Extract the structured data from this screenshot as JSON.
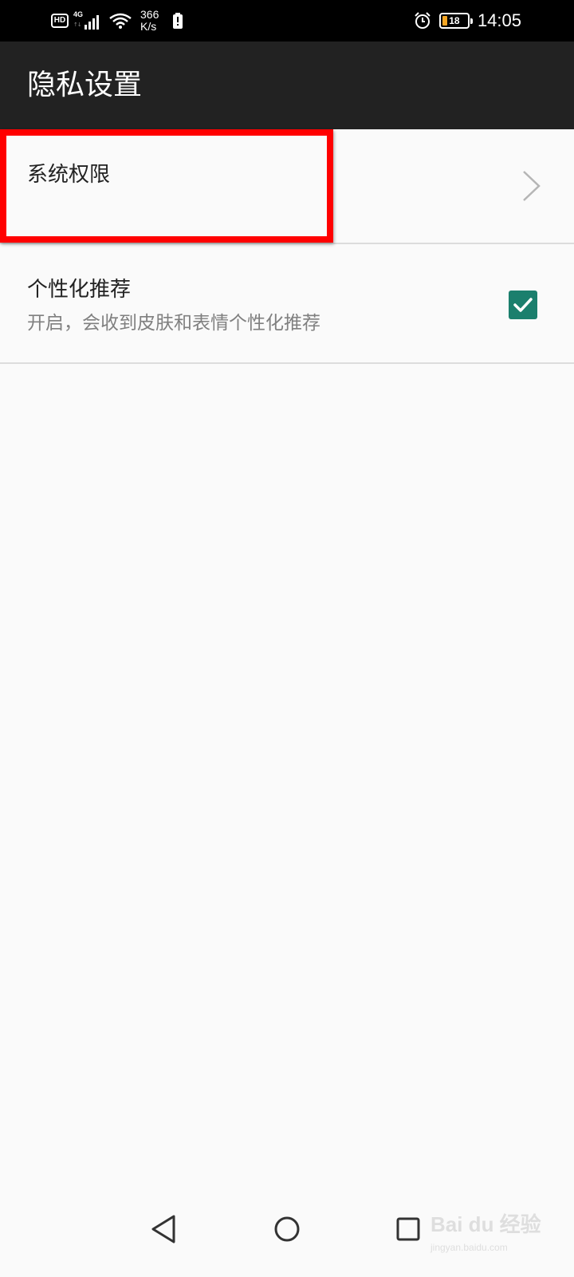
{
  "status_bar": {
    "hd_label": "HD",
    "network_label": "4G",
    "speed_value": "366",
    "speed_unit": "K/s",
    "battery_level": "18",
    "time": "14:05",
    "icons": [
      "hd-icon",
      "signal-icon",
      "wifi-icon",
      "battery-notification-icon",
      "alarm-icon",
      "battery-icon"
    ],
    "battery_fill_color": "#f5a623"
  },
  "app_bar": {
    "title": "隐私设置"
  },
  "settings": {
    "items": [
      {
        "title": "系统权限",
        "icon": "chevron-right-icon"
      },
      {
        "title": "个性化推荐",
        "subtitle": "开启，会收到皮肤和表情个性化推荐",
        "checked": true,
        "icon": "checkbox-checked-icon"
      }
    ]
  },
  "highlight": {
    "color": "#ff0000"
  },
  "nav_bar": {
    "icons": [
      "back-icon",
      "home-icon",
      "recent-apps-icon"
    ]
  },
  "watermark": {
    "logo": "Bai du 经验",
    "url": "jingyan.baidu.com"
  },
  "colors": {
    "app_bar_bg": "#222222",
    "page_bg": "#fafafa",
    "checkbox_accent": "#1b7f6d"
  }
}
